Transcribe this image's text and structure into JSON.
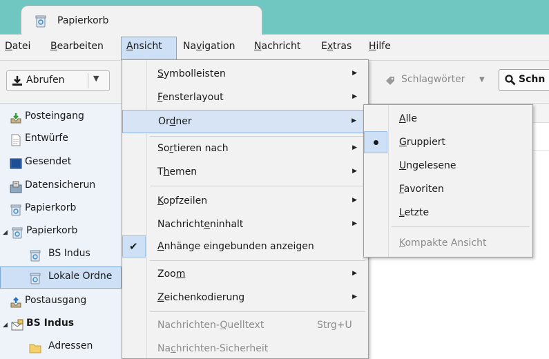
{
  "tab": {
    "title": "Papierkorb",
    "icon": "trash-folder-icon"
  },
  "menubar": [
    {
      "pre": "",
      "key": "D",
      "post": "atei"
    },
    {
      "pre": "",
      "key": "B",
      "post": "earbeiten"
    },
    {
      "pre": "",
      "key": "A",
      "post": "nsicht"
    },
    {
      "pre": "Na",
      "key": "v",
      "post": "igation"
    },
    {
      "pre": "",
      "key": "N",
      "post": "achricht"
    },
    {
      "pre": "E",
      "key": "x",
      "post": "tras"
    },
    {
      "pre": "",
      "key": "H",
      "post": "ilfe"
    }
  ],
  "toolbar": {
    "abrufen_label": "Abrufen",
    "schlagwoerter_label": "Schlagwörter",
    "schnell_label": "Schn"
  },
  "folders": [
    {
      "label": "Posteingang",
      "icon": "inbox-icon"
    },
    {
      "label": "Entwürfe",
      "icon": "drafts-icon"
    },
    {
      "label": "Gesendet",
      "icon": "sent-icon"
    },
    {
      "label": "Datensicherun",
      "icon": "archive-icon"
    },
    {
      "label": "Papierkorb",
      "icon": "trash-icon"
    },
    {
      "label": "Papierkorb",
      "icon": "trash-icon"
    },
    {
      "label": "BS Indus",
      "icon": "trash-icon"
    },
    {
      "label": "Lokale Ordne",
      "icon": "trash-icon"
    },
    {
      "label": "Postausgang",
      "icon": "outbox-icon"
    },
    {
      "label": "BS Indus",
      "icon": "account-icon"
    },
    {
      "label": "Adressen",
      "icon": "folder-icon"
    }
  ],
  "view_menu": {
    "items": [
      {
        "pre": "",
        "key": "S",
        "post": "ymbolleisten"
      },
      {
        "pre": "",
        "key": "F",
        "post": "ensterlayout"
      },
      {
        "pre": "Or",
        "key": "d",
        "post": "ner"
      },
      {
        "pre": "So",
        "key": "r",
        "post": "tieren nach"
      },
      {
        "pre": "T",
        "key": "h",
        "post": "emen"
      },
      {
        "pre": "",
        "key": "K",
        "post": "opfzeilen"
      },
      {
        "pre": "Nachricht",
        "key": "e",
        "post": "ninhalt"
      },
      {
        "pre": "",
        "key": "A",
        "post": "nhänge eingebunden anzeigen"
      },
      {
        "pre": "Zoo",
        "key": "m",
        "post": ""
      },
      {
        "pre": "",
        "key": "Z",
        "post": "eichenkodierung"
      },
      {
        "pre": "Nachrichten-",
        "key": "Q",
        "post": "uelltext"
      },
      {
        "pre": "Na",
        "key": "c",
        "post": "hrichten-Sicherheit"
      }
    ],
    "shortcut_quelltext": "Strg+U"
  },
  "folder_submenu": {
    "items": [
      {
        "pre": "",
        "key": "A",
        "post": "lle"
      },
      {
        "pre": "",
        "key": "G",
        "post": "ruppiert"
      },
      {
        "pre": "",
        "key": "U",
        "post": "ngelesene"
      },
      {
        "pre": "",
        "key": "F",
        "post": "avoriten"
      },
      {
        "pre": "",
        "key": "L",
        "post": "etzte"
      },
      {
        "pre": "",
        "key": "K",
        "post": "ompakte Ansicht"
      }
    ]
  },
  "colors": {
    "accent_teal": "#70c7c2",
    "highlight": "#cde0f5",
    "folder_pane": "#eef3fa"
  }
}
